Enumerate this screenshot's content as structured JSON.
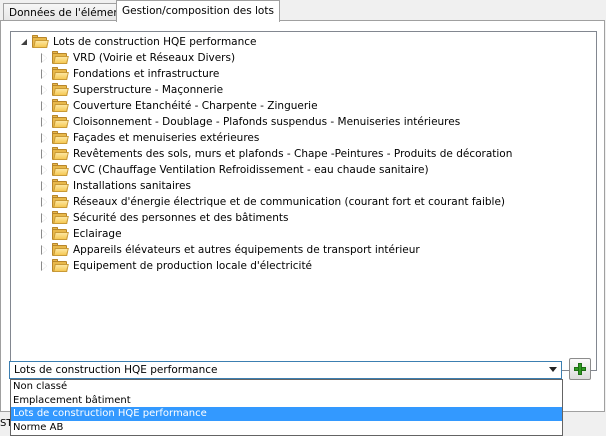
{
  "tabs": [
    {
      "label": "Données de l'élément",
      "active": false
    },
    {
      "label": "Gestion/composition des lots",
      "active": true
    }
  ],
  "tree": {
    "root": {
      "label": "Lots de construction HQE performance",
      "expanded": true
    },
    "children": [
      {
        "label": "VRD (Voirie et Réseaux Divers)"
      },
      {
        "label": "Fondations et infrastructure"
      },
      {
        "label": "Superstructure - Maçonnerie"
      },
      {
        "label": "Couverture  Etanchéité - Charpente - Zinguerie"
      },
      {
        "label": "Cloisonnement - Doublage - Plafonds suspendus - Menuiseries intérieures"
      },
      {
        "label": "Façades et menuiseries extérieures"
      },
      {
        "label": "Revêtements des sols, murs et plafonds - Chape -Peintures - Produits de décoration"
      },
      {
        "label": "CVC (Chauffage  Ventilation  Refroidissement - eau chaude sanitaire)"
      },
      {
        "label": "Installations sanitaires"
      },
      {
        "label": "Réseaux d'énergie électrique et de communication (courant fort et courant faible)"
      },
      {
        "label": "Sécurité des personnes et des bâtiments"
      },
      {
        "label": "Eclairage"
      },
      {
        "label": "Appareils élévateurs et autres équipements de transport intérieur"
      },
      {
        "label": "Equipement de production locale d'électricité"
      }
    ]
  },
  "combo": {
    "value": "Lots de construction HQE performance",
    "options": [
      {
        "label": "Non classé",
        "selected": false
      },
      {
        "label": "Emplacement bâtiment",
        "selected": false
      },
      {
        "label": "Lots de construction HQE performance",
        "selected": true
      },
      {
        "label": "Norme AB",
        "selected": false
      }
    ]
  },
  "status_fragment": "ST",
  "icons": {
    "expander_open": "triangle-down-icon",
    "expander_closed": "triangle-right-icon",
    "folder": "folder-icon",
    "add": "plus-icon"
  },
  "colors": {
    "selection": "#3399ff",
    "folder": "#f5c854",
    "add_green": "#2f9a22"
  }
}
